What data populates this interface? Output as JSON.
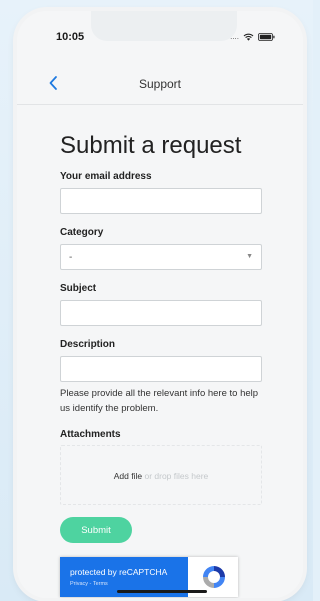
{
  "status_bar": {
    "time": "10:05",
    "signal": "....",
    "icons": [
      "wifi-icon",
      "battery-icon"
    ]
  },
  "navbar": {
    "back_icon": "chevron-left-icon",
    "title": "Support"
  },
  "form": {
    "title": "Submit a request",
    "email": {
      "label": "Your email address",
      "value": ""
    },
    "category": {
      "label": "Category",
      "selected": "-"
    },
    "subject": {
      "label": "Subject",
      "value": ""
    },
    "description": {
      "label": "Description",
      "value": "",
      "helper": "Please provide all the relevant info here to help us identify the problem."
    },
    "attachments": {
      "label": "Attachments",
      "add_file": "Add file",
      "drop_hint": "or drop files here"
    },
    "submit_label": "Submit"
  },
  "recaptcha": {
    "label": "protected by reCAPTCHA",
    "links": "Privacy - Terms"
  },
  "colors": {
    "accent": "#4ed3a0",
    "nav_back": "#1f7ae0",
    "recaptcha_blue": "#1a73e8",
    "page_background": "#e3f0f9"
  }
}
